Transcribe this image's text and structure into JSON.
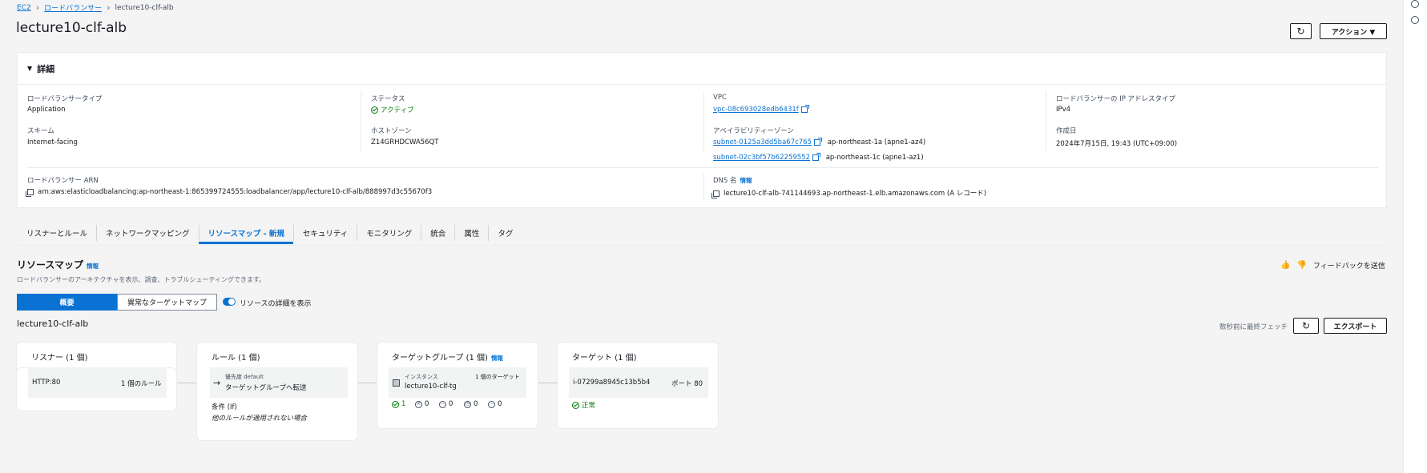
{
  "breadcrumb": {
    "root": "EC2",
    "parent": "ロードバランサー",
    "current": "lecture10-clf-alb"
  },
  "title": "lecture10-clf-alb",
  "header": {
    "actions_label": "アクション ▼"
  },
  "details": {
    "heading": "詳細",
    "type_label": "ロードバランサータイプ",
    "type_value": "Application",
    "status_label": "ステータス",
    "status_value": "アクティブ",
    "vpc_label": "VPC",
    "vpc_value": "vpc-08c693028edb6431f",
    "ip_label": "ロードバランサーの IP アドレスタイプ",
    "ip_value": "IPv4",
    "scheme_label": "スキーム",
    "scheme_value": "Internet-facing",
    "zone_label": "ホストゾーン",
    "zone_value": "Z14GRHDCWA56QT",
    "az_label": "アベイラビリティーゾーン",
    "az": [
      {
        "subnet": "subnet-0125a3dd5ba67c765",
        "zone": "ap-northeast-1a (apne1-az4)"
      },
      {
        "subnet": "subnet-02c3bf57b62259552",
        "zone": "ap-northeast-1c (apne1-az1)"
      }
    ],
    "created_label": "作成日",
    "created_value": "2024年7月15日, 19:43 (UTC+09:00)",
    "arn_label": "ロードバランサー ARN",
    "arn_value": "arn:aws:elasticloadbalancing:ap-northeast-1:865399724555:loadbalancer/app/lecture10-clf-alb/888997d3c55670f3",
    "dns_label": "DNS 名",
    "dns_info": "情報",
    "dns_value": "lecture10-clf-alb-741144693.ap-northeast-1.elb.amazonaws.com (A レコード)"
  },
  "tabs": [
    "リスナーとルール",
    "ネットワークマッピング",
    "リソースマップ - 新規",
    "セキュリティ",
    "モニタリング",
    "統合",
    "属性",
    "タグ"
  ],
  "resource_map": {
    "title": "リソースマップ",
    "info": "情報",
    "description": "ロードバランサーのアーキテクチャを表示、調査、トラブルシューティングできます。",
    "feedback": "フィードバックを送信",
    "seg_overview": "概要",
    "seg_unhealthy": "異常なターゲットマップ",
    "toggle_label": "リソースの詳細を表示",
    "lb_name": "lecture10-clf-alb",
    "fetched": "数秒前に最終フェッチ",
    "export": "エクスポート",
    "listener": {
      "title": "リスナー (1 個)",
      "protocol": "HTTP:80",
      "rules": "1 個のルール"
    },
    "rule": {
      "title": "ルール (1 個)",
      "priority": "優先度 default",
      "action": "ターゲットグループへ転送",
      "cond_label": "条件 (If)",
      "cond_value": "他のルールが適用されない場合"
    },
    "tg": {
      "title": "ターゲットグループ (1 個)",
      "info": "情報",
      "type": "インスタンス",
      "name": "lecture10-clf-tg",
      "count": "1 個のターゲット",
      "s1": "1",
      "s2": "0",
      "s3": "0",
      "s4": "0",
      "s5": "0"
    },
    "target": {
      "title": "ターゲット (1 個)",
      "id": "i-07299a8945c13b5b4",
      "port": "ポート 80",
      "status": "正常"
    }
  }
}
